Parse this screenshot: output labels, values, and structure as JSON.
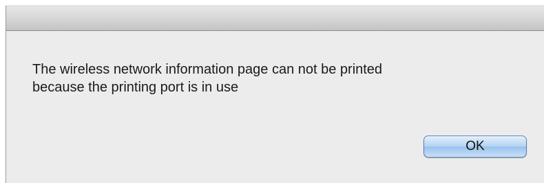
{
  "dialog": {
    "message_line1": "The wireless network information page can not be printed",
    "message_line2": "because the printing port is in use",
    "ok_label": "OK"
  },
  "colors": {
    "dialog_background": "#ececec",
    "button_accent": "#99c1ec"
  }
}
